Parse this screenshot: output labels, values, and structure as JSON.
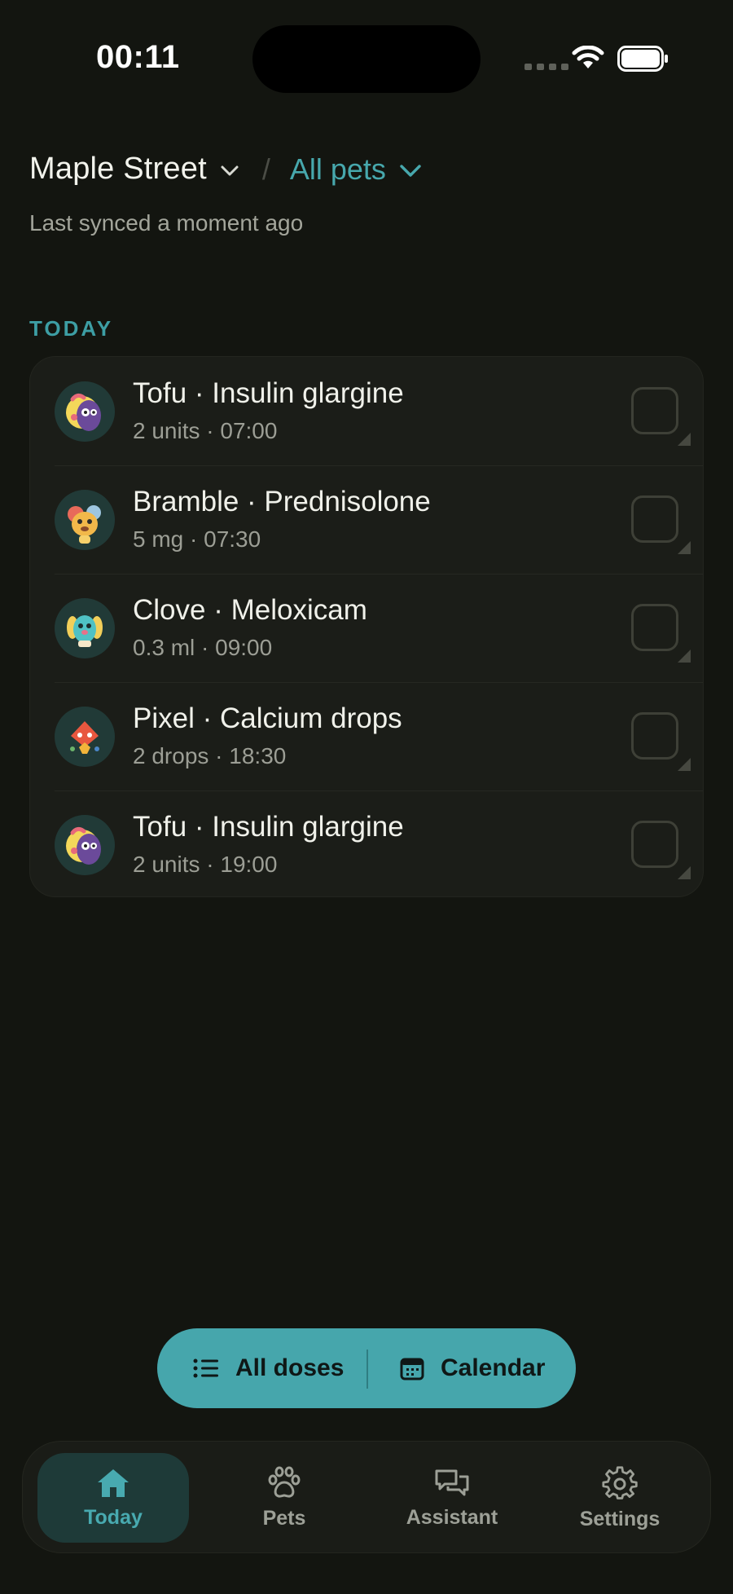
{
  "status_bar": {
    "time": "00:11"
  },
  "header": {
    "location": "Maple Street",
    "separator": "/",
    "pet_filter": "All pets",
    "sync_status": "Last synced a moment ago"
  },
  "section": {
    "label": "TODAY"
  },
  "doses": [
    {
      "title": "Tofu · Insulin glargine",
      "detail": "2 units · 07:00",
      "avatar": "tofu-avatar-icon",
      "checked": false
    },
    {
      "title": "Bramble · Prednisolone",
      "detail": "5 mg · 07:30",
      "avatar": "bramble-avatar-icon",
      "checked": false
    },
    {
      "title": "Clove · Meloxicam",
      "detail": "0.3 ml · 09:00",
      "avatar": "clove-avatar-icon",
      "checked": false
    },
    {
      "title": "Pixel · Calcium drops",
      "detail": "2 drops · 18:30",
      "avatar": "pixel-avatar-icon",
      "checked": false
    },
    {
      "title": "Tofu · Insulin glargine",
      "detail": "2 units · 19:00",
      "avatar": "tofu-avatar-icon",
      "checked": false
    }
  ],
  "actions": {
    "all_doses": "All doses",
    "calendar": "Calendar"
  },
  "tabs": [
    {
      "label": "Today",
      "icon": "home-icon",
      "active": true
    },
    {
      "label": "Pets",
      "icon": "paw-icon",
      "active": false
    },
    {
      "label": "Assistant",
      "icon": "chat-bubbles-icon",
      "active": false
    },
    {
      "label": "Settings",
      "icon": "gear-icon",
      "active": false
    }
  ],
  "colors": {
    "background": "#131510",
    "card": "#1b1d18",
    "accent": "#46a6ac",
    "accent_text": "#3d9ea4",
    "active_tab_bg": "#1e3a38"
  }
}
